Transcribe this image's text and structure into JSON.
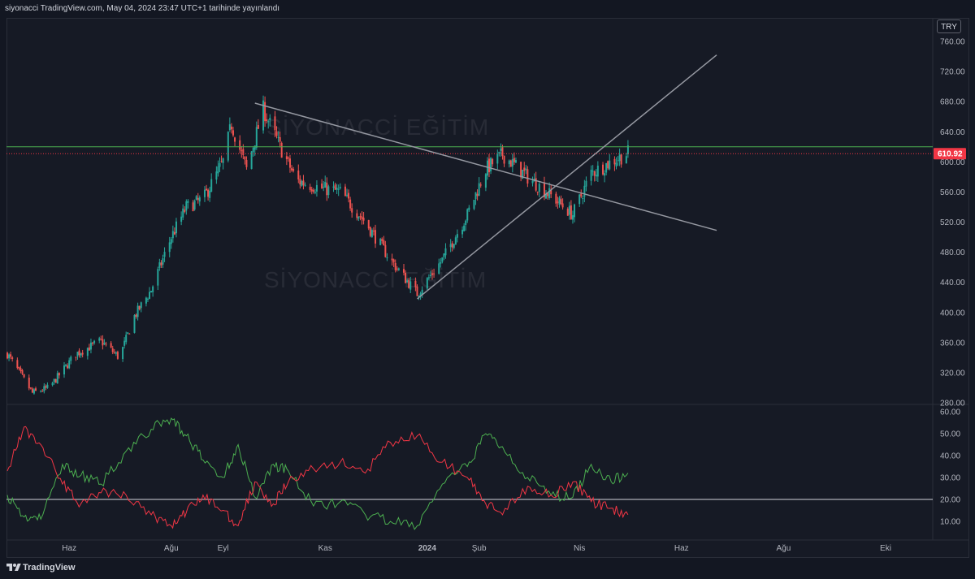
{
  "header": {
    "publish_text": "siyonacci TradingView.com, May 04, 2024 23:47 UTC+1 tarihinde yayınlandı"
  },
  "toolbar": {
    "currency": "TRY"
  },
  "footer": {
    "brand": "TradingView"
  },
  "watermarks": [
    "SİYONACCİ EĞİTİM",
    "SİYONACCİ EĞİTİM"
  ],
  "colors": {
    "background": "#131722",
    "up_candle": "#26a69a",
    "down_candle": "#ef5350",
    "green_line": "#4caf50",
    "red_line": "#f23645",
    "trend_lines": "#9598a1",
    "price_badge": "#f23645"
  },
  "chart_data": [
    {
      "type": "candlestick",
      "name": "price",
      "y_ticks": [
        "760.00",
        "720.00",
        "680.00",
        "640.00",
        "600.00",
        "560.00",
        "520.00",
        "480.00",
        "440.00",
        "400.00",
        "360.00",
        "320.00",
        "280.00"
      ],
      "ylim": [
        280,
        770
      ],
      "current_price_label": "610.92",
      "current_price": 610.92,
      "horizontal_level": 620,
      "trend_lines": [
        {
          "name": "descending-resistance",
          "start": {
            "date": "2023-09-20",
            "price": 678
          },
          "end": {
            "date": "2024-06-22",
            "price": 509
          }
        },
        {
          "name": "ascending-support",
          "start": {
            "date": "2023-12-26",
            "price": 418
          },
          "end": {
            "date": "2024-06-22",
            "price": 742
          }
        }
      ],
      "close_path": [
        {
          "date": "2023-04-25",
          "close": 345
        },
        {
          "date": "2023-05-10",
          "close": 293
        },
        {
          "date": "2023-05-20",
          "close": 300
        },
        {
          "date": "2023-06-05",
          "close": 345
        },
        {
          "date": "2023-06-20",
          "close": 362
        },
        {
          "date": "2023-07-01",
          "close": 340
        },
        {
          "date": "2023-07-10",
          "close": 395
        },
        {
          "date": "2023-07-20",
          "close": 430
        },
        {
          "date": "2023-08-01",
          "close": 500
        },
        {
          "date": "2023-08-10",
          "close": 540
        },
        {
          "date": "2023-08-20",
          "close": 550
        },
        {
          "date": "2023-09-01",
          "close": 600
        },
        {
          "date": "2023-09-06",
          "close": 650
        },
        {
          "date": "2023-09-15",
          "close": 590
        },
        {
          "date": "2023-09-25",
          "close": 670
        },
        {
          "date": "2023-10-05",
          "close": 620
        },
        {
          "date": "2023-10-15",
          "close": 575
        },
        {
          "date": "2023-10-30",
          "close": 565
        },
        {
          "date": "2023-11-10",
          "close": 560
        },
        {
          "date": "2023-11-25",
          "close": 520
        },
        {
          "date": "2023-12-10",
          "close": 470
        },
        {
          "date": "2023-12-26",
          "close": 425
        },
        {
          "date": "2024-01-10",
          "close": 470
        },
        {
          "date": "2024-01-25",
          "close": 530
        },
        {
          "date": "2024-02-05",
          "close": 590
        },
        {
          "date": "2024-02-15",
          "close": 610
        },
        {
          "date": "2024-03-01",
          "close": 580
        },
        {
          "date": "2024-03-15",
          "close": 555
        },
        {
          "date": "2024-03-28",
          "close": 530
        },
        {
          "date": "2024-04-08",
          "close": 585
        },
        {
          "date": "2024-04-20",
          "close": 600
        },
        {
          "date": "2024-04-30",
          "close": 612
        }
      ]
    },
    {
      "type": "line",
      "name": "indicator",
      "y_ticks": [
        "60.00",
        "50.00",
        "40.00",
        "30.00",
        "20.00",
        "10.00"
      ],
      "ylim": [
        5,
        62
      ],
      "horizontal_level": 20,
      "x_ticks": [
        {
          "label": "Haz",
          "date": "2023-06-01"
        },
        {
          "label": "Ağu",
          "date": "2023-08-01"
        },
        {
          "label": "Eyl",
          "date": "2023-09-01"
        },
        {
          "label": "Kas",
          "date": "2023-11-01"
        },
        {
          "label": "2024",
          "date": "2024-01-01"
        },
        {
          "label": "Şub",
          "date": "2024-02-01"
        },
        {
          "label": "Nis",
          "date": "2024-04-01"
        },
        {
          "label": "Haz",
          "date": "2024-06-01"
        },
        {
          "label": "Ağu",
          "date": "2024-08-01"
        },
        {
          "label": "Eki",
          "date": "2024-10-01"
        }
      ],
      "series": [
        {
          "color": "#4caf50",
          "points": [
            {
              "date": "2023-04-25",
              "value": 22
            },
            {
              "date": "2023-05-05",
              "value": 12
            },
            {
              "date": "2023-05-15",
              "value": 11
            },
            {
              "date": "2023-05-28",
              "value": 36
            },
            {
              "date": "2023-06-08",
              "value": 31
            },
            {
              "date": "2023-06-20",
              "value": 27
            },
            {
              "date": "2023-07-05",
              "value": 42
            },
            {
              "date": "2023-07-20",
              "value": 52
            },
            {
              "date": "2023-08-01",
              "value": 57
            },
            {
              "date": "2023-08-10",
              "value": 49
            },
            {
              "date": "2023-08-20",
              "value": 38
            },
            {
              "date": "2023-09-01",
              "value": 30
            },
            {
              "date": "2023-09-10",
              "value": 45
            },
            {
              "date": "2023-09-20",
              "value": 21
            },
            {
              "date": "2023-10-01",
              "value": 36
            },
            {
              "date": "2023-10-10",
              "value": 33
            },
            {
              "date": "2023-10-25",
              "value": 17
            },
            {
              "date": "2023-11-10",
              "value": 19
            },
            {
              "date": "2023-11-25",
              "value": 13
            },
            {
              "date": "2023-12-10",
              "value": 10
            },
            {
              "date": "2023-12-26",
              "value": 8
            },
            {
              "date": "2024-01-10",
              "value": 27
            },
            {
              "date": "2024-01-25",
              "value": 35
            },
            {
              "date": "2024-02-05",
              "value": 50
            },
            {
              "date": "2024-02-15",
              "value": 44
            },
            {
              "date": "2024-03-01",
              "value": 30
            },
            {
              "date": "2024-03-15",
              "value": 22
            },
            {
              "date": "2024-03-28",
              "value": 21
            },
            {
              "date": "2024-04-08",
              "value": 36
            },
            {
              "date": "2024-04-20",
              "value": 28
            },
            {
              "date": "2024-04-30",
              "value": 32
            }
          ]
        },
        {
          "color": "#f23645",
          "points": [
            {
              "date": "2023-04-25",
              "value": 33
            },
            {
              "date": "2023-05-05",
              "value": 53
            },
            {
              "date": "2023-05-15",
              "value": 45
            },
            {
              "date": "2023-05-28",
              "value": 27
            },
            {
              "date": "2023-06-08",
              "value": 18
            },
            {
              "date": "2023-06-20",
              "value": 23
            },
            {
              "date": "2023-07-05",
              "value": 22
            },
            {
              "date": "2023-07-20",
              "value": 13
            },
            {
              "date": "2023-08-01",
              "value": 8
            },
            {
              "date": "2023-08-10",
              "value": 14
            },
            {
              "date": "2023-08-20",
              "value": 22
            },
            {
              "date": "2023-09-01",
              "value": 15
            },
            {
              "date": "2023-09-10",
              "value": 8
            },
            {
              "date": "2023-09-20",
              "value": 28
            },
            {
              "date": "2023-10-01",
              "value": 18
            },
            {
              "date": "2023-10-10",
              "value": 28
            },
            {
              "date": "2023-10-25",
              "value": 34
            },
            {
              "date": "2023-11-10",
              "value": 37
            },
            {
              "date": "2023-11-25",
              "value": 32
            },
            {
              "date": "2023-12-10",
              "value": 46
            },
            {
              "date": "2023-12-26",
              "value": 49
            },
            {
              "date": "2024-01-10",
              "value": 37
            },
            {
              "date": "2024-01-25",
              "value": 30
            },
            {
              "date": "2024-02-05",
              "value": 18
            },
            {
              "date": "2024-02-15",
              "value": 13
            },
            {
              "date": "2024-03-01",
              "value": 26
            },
            {
              "date": "2024-03-15",
              "value": 22
            },
            {
              "date": "2024-03-28",
              "value": 28
            },
            {
              "date": "2024-04-08",
              "value": 19
            },
            {
              "date": "2024-04-20",
              "value": 16
            },
            {
              "date": "2024-04-30",
              "value": 13
            }
          ]
        }
      ]
    }
  ]
}
